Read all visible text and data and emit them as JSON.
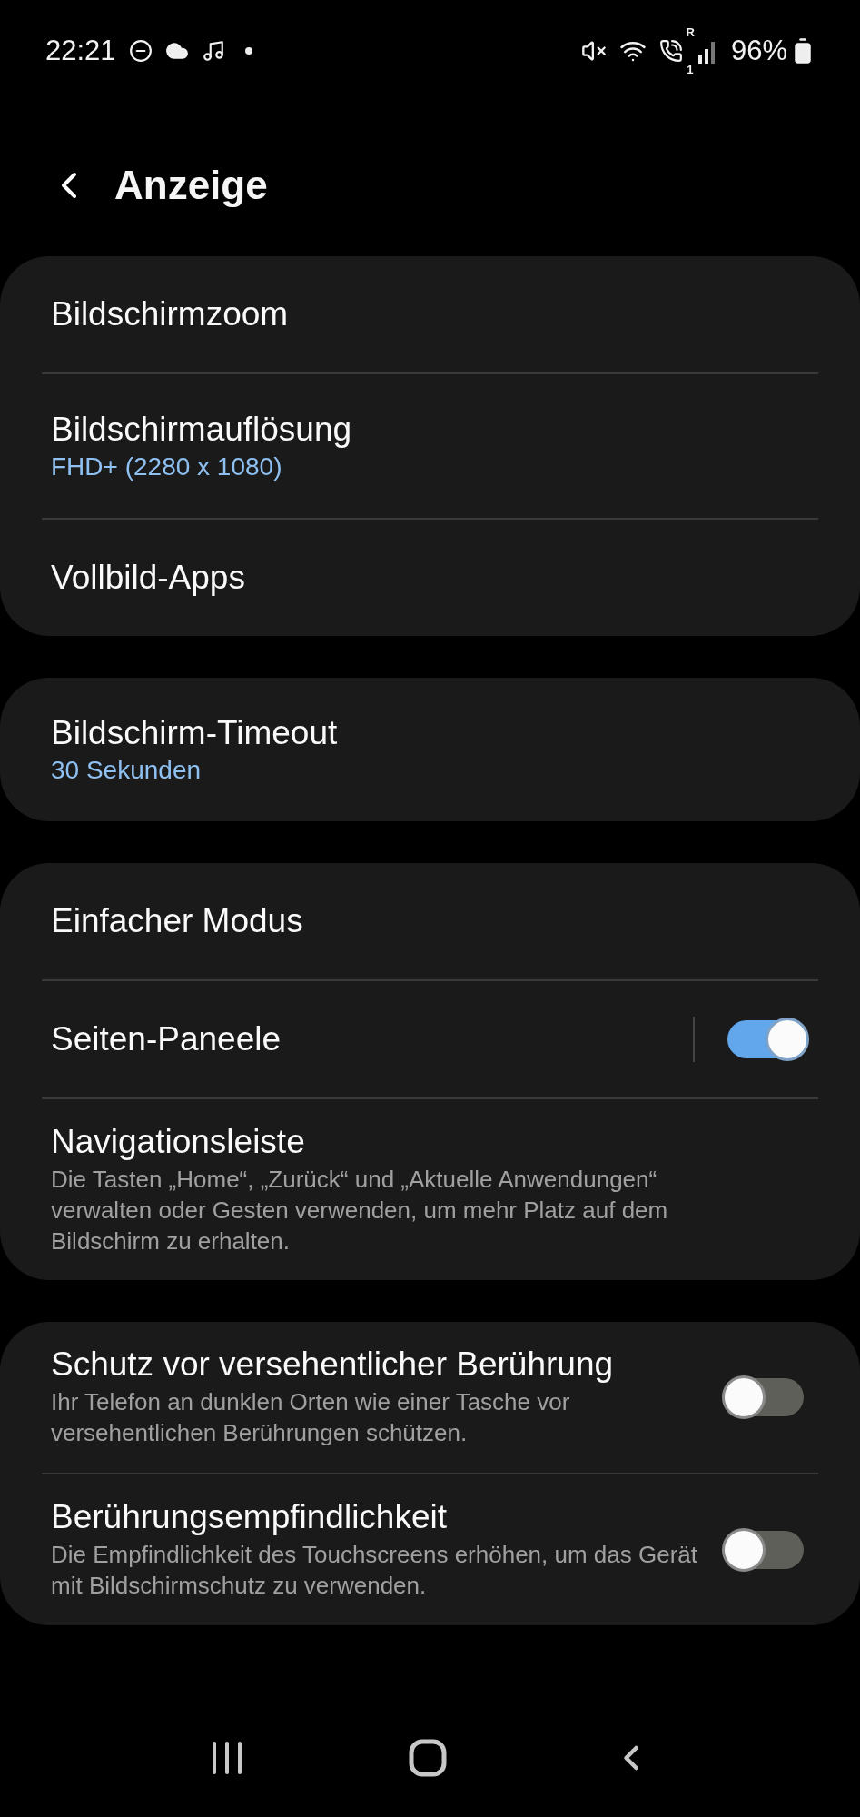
{
  "status_bar": {
    "time": "22:21",
    "call_sim": "1",
    "roaming": "R",
    "battery": "96%"
  },
  "header": {
    "title": "Anzeige"
  },
  "groups": [
    {
      "items": [
        {
          "kind": "plain",
          "title": "Bildschirmzoom"
        },
        {
          "kind": "plain",
          "title": "Bildschirmauflösung",
          "value": "FHD+ (2280 x 1080)"
        },
        {
          "kind": "plain",
          "title": "Vollbild-Apps"
        }
      ]
    },
    {
      "items": [
        {
          "kind": "plain",
          "title": "Bildschirm-Timeout",
          "value": "30 Sekunden"
        }
      ]
    },
    {
      "items": [
        {
          "kind": "plain",
          "title": "Einfacher Modus"
        },
        {
          "kind": "toggle",
          "title": "Seiten-Paneele",
          "divided": true,
          "on": true
        },
        {
          "kind": "plain",
          "title": "Navigationsleiste",
          "description": "Die Tasten „Home“, „Zurück“ und „Aktuelle Anwendungen“ verwalten oder Gesten verwenden, um mehr Platz auf dem Bildschirm zu erhalten."
        }
      ]
    },
    {
      "items": [
        {
          "kind": "toggle",
          "title": "Schutz vor versehentlicher Berührung",
          "description": "Ihr Telefon an dunklen Orten wie einer Tasche vor versehentlichen Berührungen schützen.",
          "divided": false,
          "on": false
        },
        {
          "kind": "toggle",
          "title": "Berührungsempfindlichkeit",
          "description": "Die Empfindlichkeit des Touchscreens erhöhen, um das Gerät mit Bildschirmschutz zu verwenden.",
          "divided": false,
          "on": false
        }
      ]
    }
  ]
}
